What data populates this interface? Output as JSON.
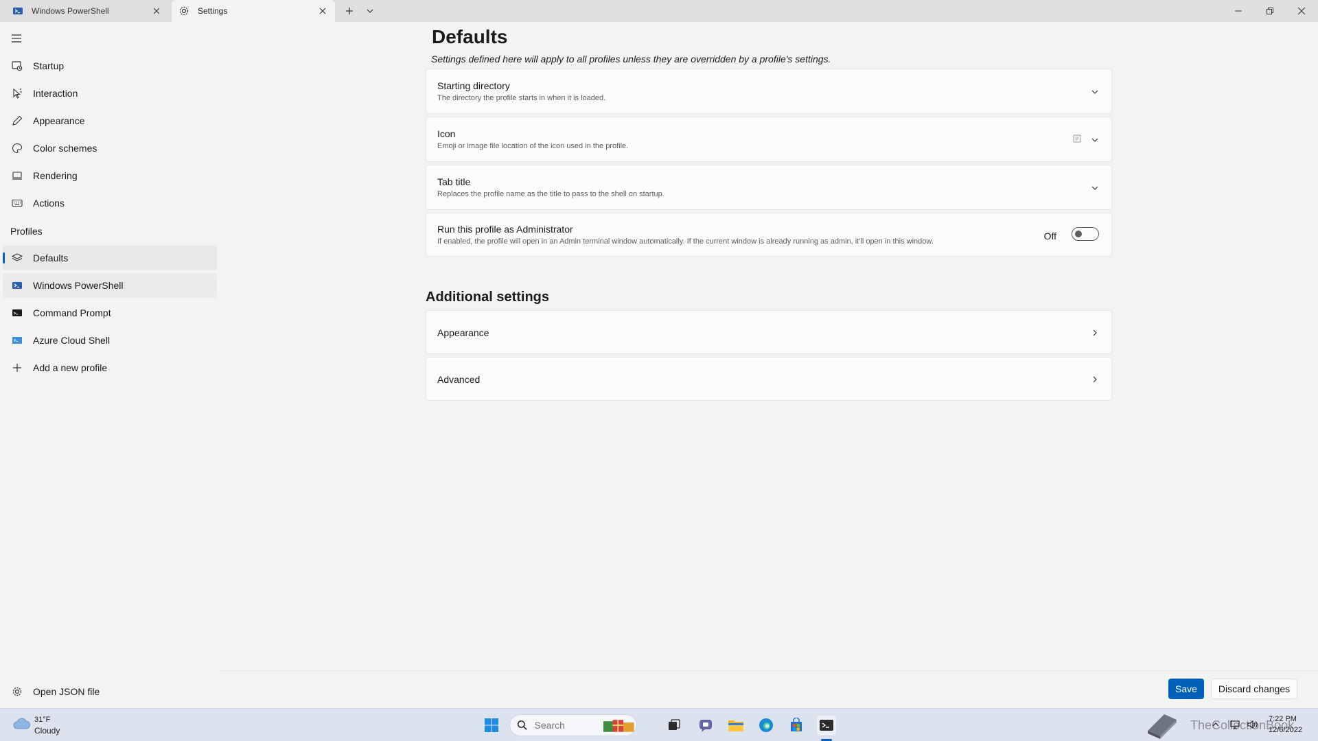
{
  "tabs": [
    {
      "label": "Windows PowerShell",
      "icon": "powershell-icon"
    },
    {
      "label": "Settings",
      "icon": "gear-icon"
    }
  ],
  "sidebar": {
    "items": [
      {
        "label": "Startup",
        "icon": "startup-icon"
      },
      {
        "label": "Interaction",
        "icon": "cursor-icon"
      },
      {
        "label": "Appearance",
        "icon": "pen-icon"
      },
      {
        "label": "Color schemes",
        "icon": "palette-icon"
      },
      {
        "label": "Rendering",
        "icon": "monitor-icon"
      },
      {
        "label": "Actions",
        "icon": "keyboard-icon"
      }
    ],
    "profiles_header": "Profiles",
    "profiles": [
      {
        "label": "Defaults",
        "icon": "layers-icon"
      },
      {
        "label": "Windows PowerShell",
        "icon": "powershell-icon"
      },
      {
        "label": "Command Prompt",
        "icon": "cmd-icon"
      },
      {
        "label": "Azure Cloud Shell",
        "icon": "azure-icon"
      },
      {
        "label": "Add a new profile",
        "icon": "plus-icon"
      }
    ],
    "open_json": "Open JSON file"
  },
  "main": {
    "title": "Defaults",
    "subtitle": "Settings defined here will apply to all profiles unless they are overridden by a profile's settings.",
    "settings": [
      {
        "title": "Starting directory",
        "desc": "The directory the profile starts in when it is loaded."
      },
      {
        "title": "Icon",
        "desc": "Emoji or image file location of the icon used in the profile."
      },
      {
        "title": "Tab title",
        "desc": "Replaces the profile name as the title to pass to the shell on startup."
      },
      {
        "title": "Run this profile as Administrator",
        "desc": "If enabled, the profile will open in an Admin terminal window automatically. If the current window is already running as admin, it'll open in this window.",
        "toggle": "Off"
      }
    ],
    "additional_title": "Additional settings",
    "additional": [
      {
        "title": "Appearance"
      },
      {
        "title": "Advanced"
      }
    ]
  },
  "footer": {
    "save": "Save",
    "discard": "Discard changes"
  },
  "taskbar": {
    "weather_temp": "31°F",
    "weather_cond": "Cloudy",
    "search_placeholder": "Search",
    "watermark": "TheCollectionBook",
    "time": "7:22 PM",
    "date": "12/6/2022"
  },
  "colors": {
    "accent": "#005fb8",
    "background": "#f3f3f3",
    "card": "#fbfbfb"
  }
}
